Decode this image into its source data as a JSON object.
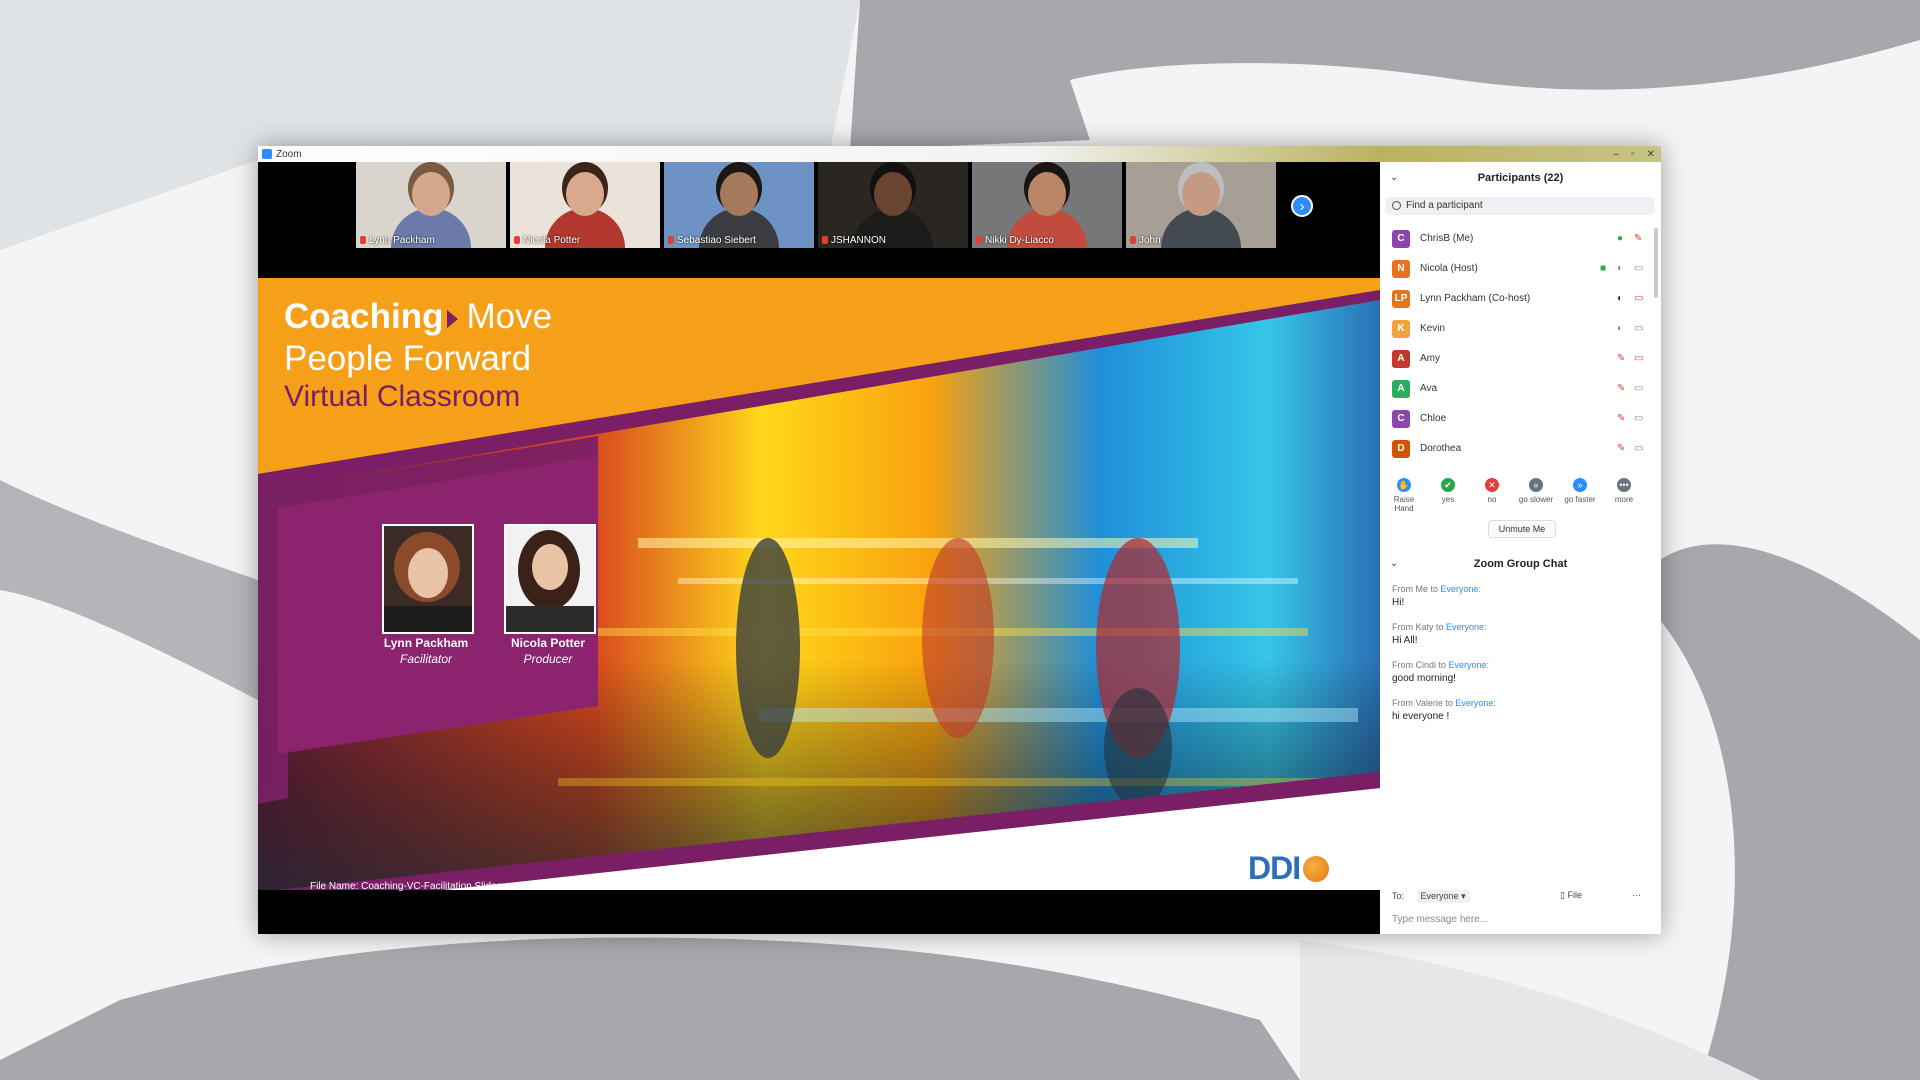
{
  "window": {
    "title": "Zoom",
    "controls": [
      "–",
      "▫",
      "✕"
    ]
  },
  "gallery": {
    "tiles": [
      {
        "name": "Lynn Packham",
        "bg": "#d9d5cc",
        "skin": "#d4a88c",
        "hair": "#7a5a40",
        "shirt": "#6b7aa8"
      },
      {
        "name": "Nicola Potter",
        "bg": "#e9e3da",
        "skin": "#d9a98d",
        "hair": "#3b2418",
        "shirt": "#b2372e"
      },
      {
        "name": "Sebastiao Siebert",
        "bg": "#6c93c4",
        "skin": "#a57a5c",
        "hair": "#1d1612",
        "shirt": "#3b3d42"
      },
      {
        "name": "JSHANNON",
        "bg": "#2a2622",
        "skin": "#6b4430",
        "hair": "#141010",
        "shirt": "#1e1c1b"
      },
      {
        "name": "Nikki Dy-Liacco",
        "bg": "#77777a",
        "skin": "#b98768",
        "hair": "#1b1512",
        "shirt": "#c14c3e"
      },
      {
        "name": "John",
        "bg": "#a69f95",
        "skin": "#c59a82",
        "hair": "#bdbdbd",
        "shirt": "#444a52"
      }
    ]
  },
  "slide": {
    "title_bold": "Coaching",
    "title_rest": "Move",
    "title_line2": "People Forward",
    "subtitle": "Virtual Classroom",
    "presenters": [
      {
        "name": "Lynn Packham",
        "role": "Facilitator"
      },
      {
        "name": "Nicola Potter",
        "role": "Producer"
      }
    ],
    "file_name": "File Name: Coaching-VC-Facilitation Slides",
    "logo_text": "DDI"
  },
  "participants": {
    "title": "Participants (22)",
    "search_placeholder": "Find a participant",
    "list": [
      {
        "initials": "C",
        "name": "ChrisB (Me)",
        "color": "#8e44ad",
        "icons": [
          "✔",
          "🎤"
        ]
      },
      {
        "initials": "N",
        "name": "Nicola (Host)",
        "color": "#e8731c",
        "icons": [
          "▣",
          "🎤",
          "▭"
        ]
      },
      {
        "initials": "LP",
        "name": "Lynn Packham (Co-host)",
        "color": "#e8731c",
        "icons": [
          "🎤",
          "▭"
        ]
      },
      {
        "initials": "K",
        "name": "Kevin",
        "color": "#f2a23a",
        "icons": [
          "🎤",
          "▭"
        ]
      },
      {
        "initials": "A",
        "name": "Amy",
        "color": "#c0392b",
        "icons": [
          "🎤",
          "▭"
        ]
      },
      {
        "initials": "A",
        "name": "Ava",
        "color": "#27ae60",
        "icons": [
          "🎤",
          "▭"
        ]
      },
      {
        "initials": "C",
        "name": "Chloe",
        "color": "#8e44ad",
        "icons": [
          "🎤",
          "▭"
        ]
      },
      {
        "initials": "D",
        "name": "Dorothea",
        "color": "#d35400",
        "icons": [
          "🎤",
          "▭"
        ]
      }
    ],
    "reactions": [
      {
        "label": "Raise Hand",
        "color": "#2d8cff",
        "glyph": "✋"
      },
      {
        "label": "yes",
        "color": "#28a745",
        "glyph": "✔"
      },
      {
        "label": "no",
        "color": "#e0403a",
        "glyph": "✕"
      },
      {
        "label": "go slower",
        "color": "#6b7280",
        "glyph": "«"
      },
      {
        "label": "go faster",
        "color": "#2d8cff",
        "glyph": "»"
      },
      {
        "label": "more",
        "color": "#6b7280",
        "glyph": "•••"
      }
    ],
    "unmute_label": "Unmute Me"
  },
  "chat": {
    "title": "Zoom Group Chat",
    "messages": [
      {
        "from": "From Me to",
        "to": "Everyone:",
        "text": "Hi!"
      },
      {
        "from": "From Katy to",
        "to": "Everyone:",
        "text": "Hi All!"
      },
      {
        "from": "From Cindi to",
        "to": "Everyone:",
        "text": "good morning!"
      },
      {
        "from": "From Valerie to",
        "to": "Everyone:",
        "text": "hi everyone !"
      }
    ],
    "to_label": "To:",
    "recipient": "Everyone",
    "file_label": "File",
    "more_label": "···",
    "input_placeholder": "Type message here..."
  }
}
